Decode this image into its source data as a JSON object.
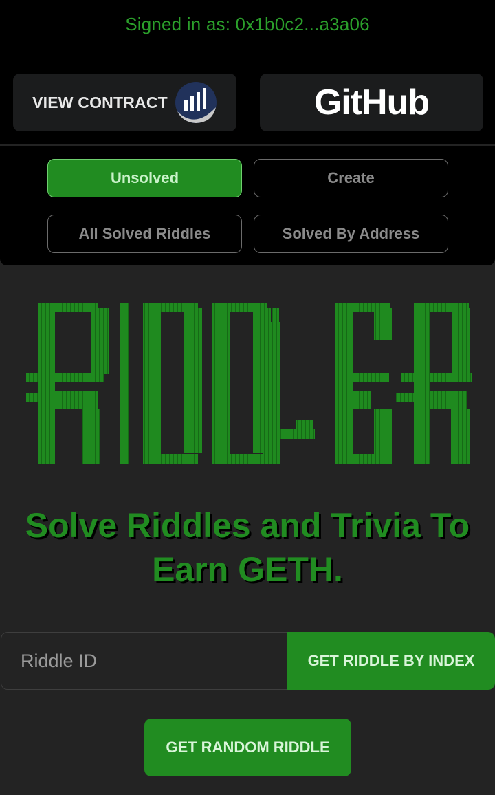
{
  "header": {
    "signed_in_text": "Signed in as: 0x1b0c2...a3a06",
    "view_contract_label": "VIEW CONTRACT",
    "contract_icon": "etherscan-logo-icon",
    "github_label": "GitHub"
  },
  "tabs": [
    {
      "label": "Unsolved",
      "active": true
    },
    {
      "label": "Create",
      "active": false
    },
    {
      "label": "All Solved Riddles",
      "active": false
    },
    {
      "label": "Solved By Address",
      "active": false
    }
  ],
  "logo": {
    "text": "RIDDLER",
    "color": "#1f8a1f"
  },
  "tagline": "Solve Riddles and Trivia To Earn GETH.",
  "riddle_form": {
    "input_placeholder": "Riddle ID",
    "input_value": "",
    "get_by_index_label": "GET RIDDLE BY INDEX",
    "get_random_label": "GET RANDOM RIDDLE"
  },
  "colors": {
    "accent_green": "#218c21",
    "background": "#232323",
    "header_background": "#000000"
  }
}
